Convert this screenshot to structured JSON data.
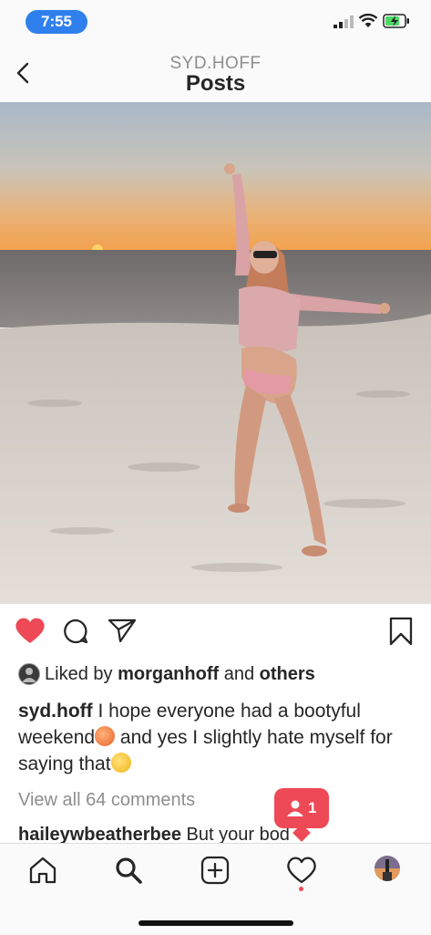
{
  "status_bar": {
    "time": "7:55"
  },
  "header": {
    "username": "SYD.HOFF",
    "title": "Posts"
  },
  "post": {
    "liked_prefix": "Liked by ",
    "liked_user": "morganhoff",
    "liked_and": " and ",
    "liked_others": "others",
    "caption_user": "syd.hoff",
    "caption_part1": " I hope everyone had a bootyful weekend",
    "caption_part2": " and yes I slightly hate myself for saying that",
    "view_all_comments": "View all 64 comments",
    "comment_user": "haileywbeatherbee",
    "comment_text": " But your bod"
  },
  "notification": {
    "count": "1"
  },
  "icons": {
    "back": "chevron-left-icon",
    "like": "heart-filled-icon",
    "comment": "comment-icon",
    "share": "paper-plane-icon",
    "save": "bookmark-icon",
    "home": "home-icon",
    "search": "search-icon",
    "new_post": "plus-square-icon",
    "activity": "heart-outline-icon",
    "profile": "profile-avatar"
  },
  "colors": {
    "like_red": "#ed4956",
    "time_pill": "#2f80ed",
    "battery_green": "#4cd964"
  }
}
